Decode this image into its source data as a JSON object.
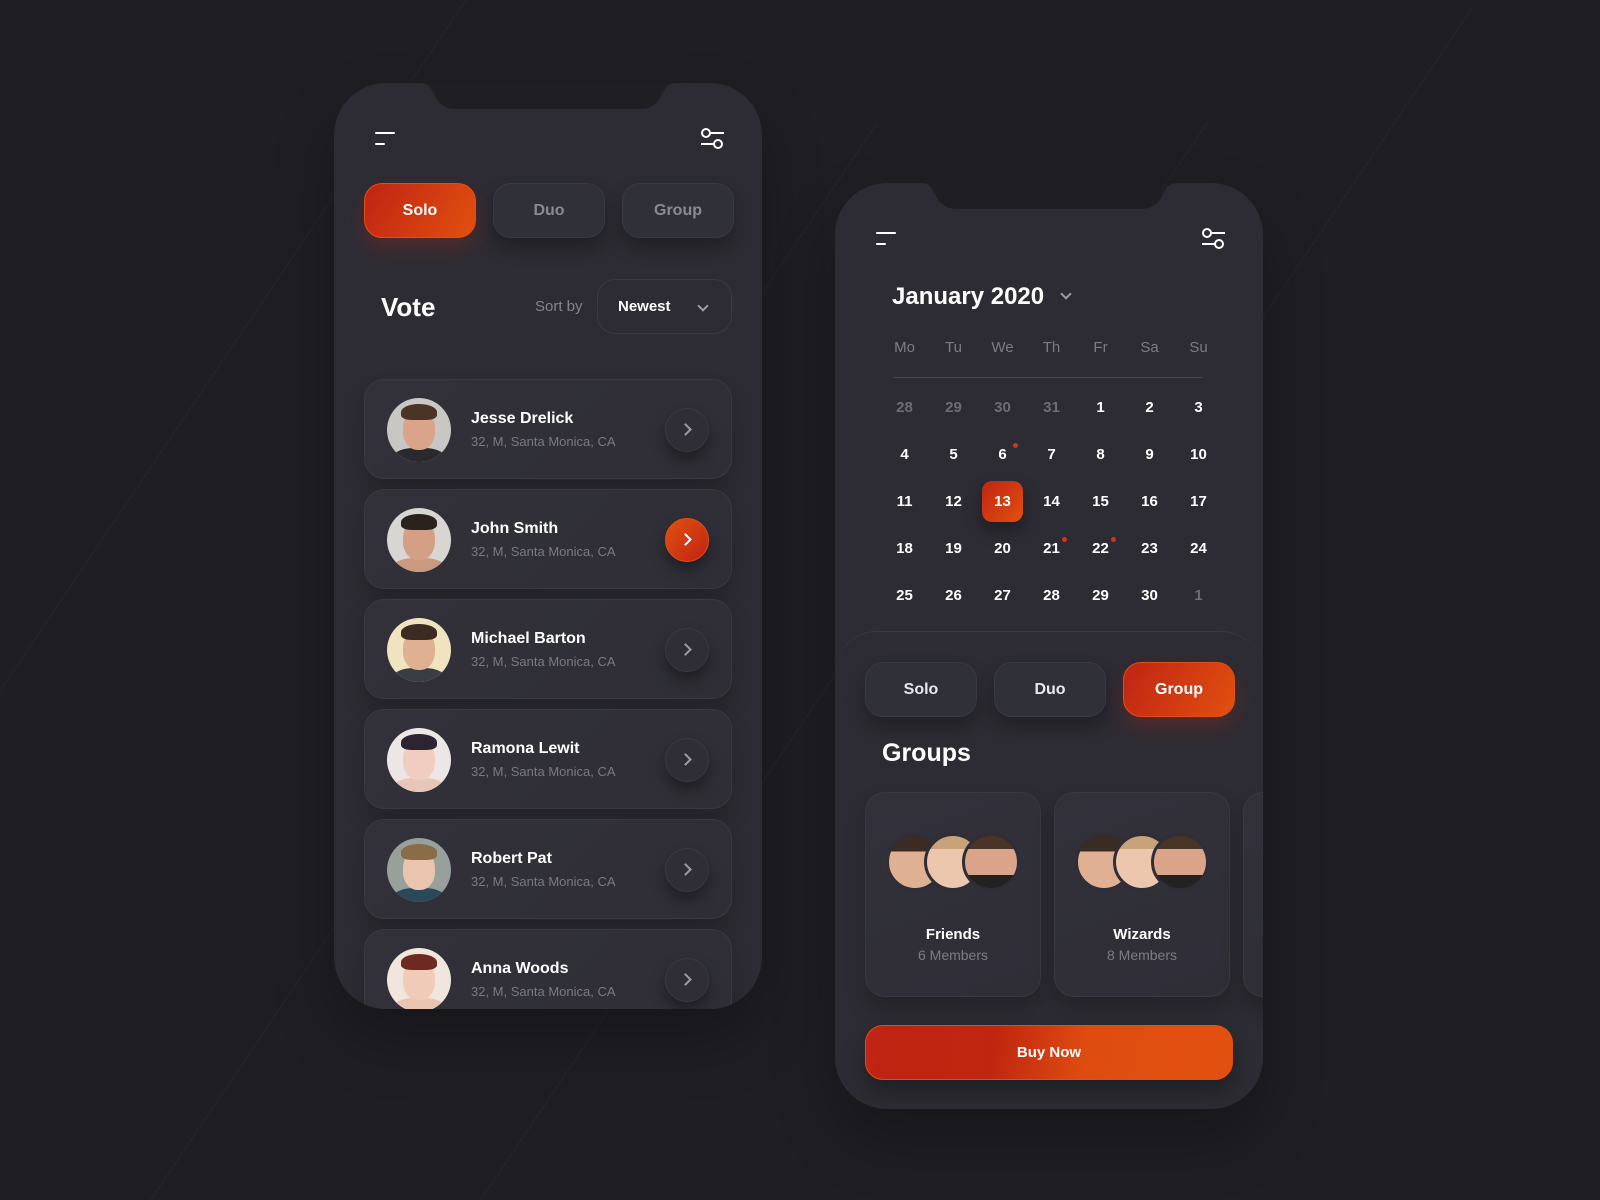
{
  "colors": {
    "background": "#1f1e23",
    "phone": "#2d2c34",
    "accent_start": "#bf2414",
    "accent_end": "#e2500f",
    "muted_text": "#7a7982"
  },
  "vote_screen": {
    "menu_icon": "menu-icon",
    "filter_icon": "sliders-icon",
    "tabs": [
      {
        "label": "Solo",
        "active": true
      },
      {
        "label": "Duo",
        "active": false
      },
      {
        "label": "Group",
        "active": false
      }
    ],
    "title": "Vote",
    "sort_label": "Sort by",
    "sort_value": "Newest",
    "people": [
      {
        "name": "Jesse Drelick",
        "meta": "32, M, Santa Monica, CA",
        "highlighted": false
      },
      {
        "name": "John Smith",
        "meta": "32, M, Santa Monica, CA",
        "highlighted": true
      },
      {
        "name": "Michael Barton",
        "meta": "32, M, Santa Monica, CA",
        "highlighted": false
      },
      {
        "name": "Ramona Lewit",
        "meta": "32, M, Santa Monica, CA",
        "highlighted": false
      },
      {
        "name": "Robert Pat",
        "meta": "32, M, Santa Monica, CA",
        "highlighted": false
      },
      {
        "name": "Anna Woods",
        "meta": "32, M, Santa Monica, CA",
        "highlighted": false
      }
    ]
  },
  "calendar_screen": {
    "menu_icon": "menu-icon",
    "filter_icon": "sliders-icon",
    "month_title": "January 2020",
    "weekdays": [
      "Mo",
      "Tu",
      "We",
      "Th",
      "Fr",
      "Sa",
      "Su"
    ],
    "days": [
      {
        "d": "28",
        "muted": true
      },
      {
        "d": "29",
        "muted": true
      },
      {
        "d": "30",
        "muted": true
      },
      {
        "d": "31",
        "muted": true
      },
      {
        "d": "1"
      },
      {
        "d": "2"
      },
      {
        "d": "3"
      },
      {
        "d": "4"
      },
      {
        "d": "5"
      },
      {
        "d": "6",
        "event": true
      },
      {
        "d": "7"
      },
      {
        "d": "8"
      },
      {
        "d": "9"
      },
      {
        "d": "10"
      },
      {
        "d": "11"
      },
      {
        "d": "12"
      },
      {
        "d": "13",
        "selected": true
      },
      {
        "d": "14"
      },
      {
        "d": "15"
      },
      {
        "d": "16"
      },
      {
        "d": "17"
      },
      {
        "d": "18"
      },
      {
        "d": "19"
      },
      {
        "d": "20"
      },
      {
        "d": "21",
        "event": true
      },
      {
        "d": "22",
        "event": true
      },
      {
        "d": "23"
      },
      {
        "d": "24"
      },
      {
        "d": "25"
      },
      {
        "d": "26"
      },
      {
        "d": "27"
      },
      {
        "d": "28"
      },
      {
        "d": "29"
      },
      {
        "d": "30"
      },
      {
        "d": "1",
        "muted": true
      }
    ],
    "tabs": [
      {
        "label": "Solo",
        "active": false
      },
      {
        "label": "Duo",
        "active": false
      },
      {
        "label": "Group",
        "active": true
      }
    ],
    "groups_title": "Groups",
    "groups": [
      {
        "name": "Friends",
        "members": "6 Members"
      },
      {
        "name": "Wizards",
        "members": "8 Members"
      }
    ],
    "buy_label": "Buy Now"
  }
}
